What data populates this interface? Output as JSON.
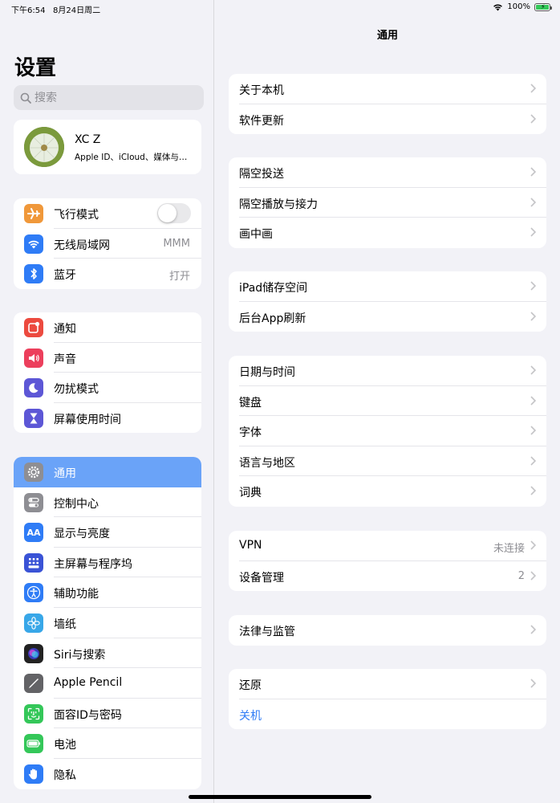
{
  "status_bar": {
    "time": "下午6:54",
    "date": "8月24日周二",
    "battery": "100%"
  },
  "sidebar": {
    "title": "设置",
    "search_placeholder": "搜索",
    "profile": {
      "name": "XC Z",
      "subtitle": "Apple ID、iCloud、媒体与…"
    },
    "groups": [
      [
        {
          "label": "飞行模式",
          "icon": "airplane-icon",
          "color": "#f0983a",
          "toggle": false
        },
        {
          "label": "无线局域网",
          "icon": "wifi-icon",
          "color": "#2f7cf6",
          "value": "MMM"
        },
        {
          "label": "蓝牙",
          "icon": "bluetooth-icon",
          "color": "#2f7cf6",
          "value": "打开"
        }
      ],
      [
        {
          "label": "通知",
          "icon": "notifications-icon",
          "color": "#ec4a3f"
        },
        {
          "label": "声音",
          "icon": "sound-icon",
          "color": "#ec3f5c"
        },
        {
          "label": "勿扰模式",
          "icon": "moon-icon",
          "color": "#5d57d6"
        },
        {
          "label": "屏幕使用时间",
          "icon": "hourglass-icon",
          "color": "#5d57d6"
        }
      ],
      [
        {
          "label": "通用",
          "icon": "gear-icon",
          "color": "#8e8e93",
          "active": true
        },
        {
          "label": "控制中心",
          "icon": "control-center-icon",
          "color": "#8e8e93"
        },
        {
          "label": "显示与亮度",
          "icon": "display-icon",
          "color": "#2f7cf6"
        },
        {
          "label": "主屏幕与程序坞",
          "icon": "home-screen-icon",
          "color": "#3a53d6"
        },
        {
          "label": "辅助功能",
          "icon": "accessibility-icon",
          "color": "#2f7cf6"
        },
        {
          "label": "墙纸",
          "icon": "wallpaper-icon",
          "color": "#38a7e8"
        },
        {
          "label": "Siri与搜索",
          "icon": "siri-icon",
          "color": "#222222"
        },
        {
          "label": "Apple Pencil",
          "icon": "pencil-icon",
          "color": "#636366"
        },
        {
          "label": "面容ID与密码",
          "icon": "face-id-icon",
          "color": "#34c759"
        },
        {
          "label": "电池",
          "icon": "battery-icon",
          "color": "#34c759"
        },
        {
          "label": "隐私",
          "icon": "hand-icon",
          "color": "#2f7cf6"
        }
      ]
    ]
  },
  "main": {
    "title": "通用",
    "groups": [
      [
        {
          "label": "关于本机"
        },
        {
          "label": "软件更新"
        }
      ],
      [
        {
          "label": "隔空投送"
        },
        {
          "label": "隔空播放与接力"
        },
        {
          "label": "画中画"
        }
      ],
      [
        {
          "label": "iPad储存空间"
        },
        {
          "label": "后台App刷新"
        }
      ],
      [
        {
          "label": "日期与时间"
        },
        {
          "label": "键盘"
        },
        {
          "label": "字体"
        },
        {
          "label": "语言与地区"
        },
        {
          "label": "词典"
        }
      ],
      [
        {
          "label": "VPN",
          "value": "未连接"
        },
        {
          "label": "设备管理",
          "value": "2"
        }
      ],
      [
        {
          "label": "法律与监管"
        }
      ],
      [
        {
          "label": "还原"
        },
        {
          "label": "关机",
          "blue": true,
          "no_chevron": true
        }
      ]
    ]
  }
}
